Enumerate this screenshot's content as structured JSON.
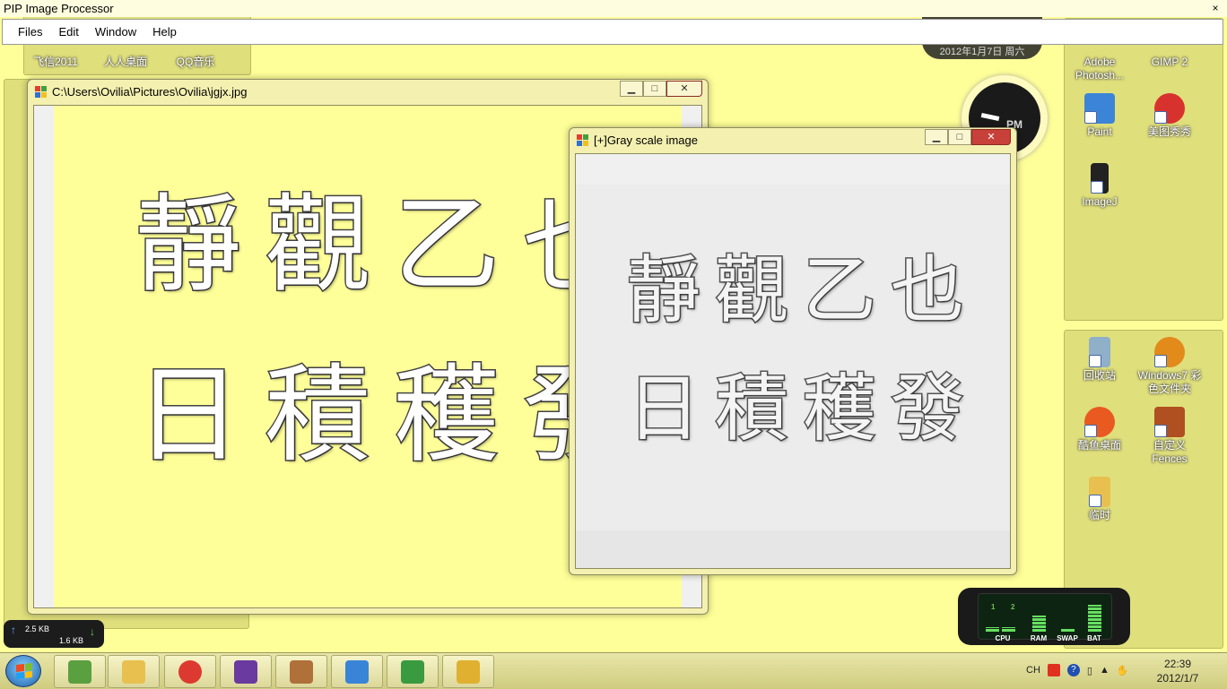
{
  "app": {
    "title": "PIP Image Processor",
    "close": "×"
  },
  "menu": [
    "Files",
    "Edit",
    "Window",
    "Help"
  ],
  "original_window": {
    "title": "C:\\Users\\Ovilia\\Pictures\\Ovilia\\jgjx.jpg",
    "glyphs": [
      "靜",
      "觀",
      "乙",
      "也",
      "日",
      "積",
      "穫",
      "發"
    ]
  },
  "gray_window": {
    "title": "[+]Gray scale image",
    "glyphs": [
      "靜",
      "觀",
      "乙",
      "也",
      "日",
      "積",
      "穫",
      "發"
    ]
  },
  "desktop_icons_left": [
    "飞信2011",
    "人人桌面",
    "QQ音乐"
  ],
  "desktop_icons_right": [
    {
      "label": "Adobe Photosh...",
      "color": "#1d3f74"
    },
    {
      "label": "GIMP 2",
      "color": "#7a6a52"
    },
    {
      "label": "Paint",
      "color": "#3c84d8"
    },
    {
      "label": "美图秀秀",
      "color": "#d8322e"
    },
    {
      "label": "ImageJ",
      "color": "#222222"
    },
    {
      "label": "回收站",
      "color": "#8fb0c8"
    },
    {
      "label": "Windows7 彩色文件夹",
      "color": "#e28a1a"
    },
    {
      "label": "酷鱼桌面",
      "color": "#e85a20"
    },
    {
      "label": "自定义 Fences",
      "color": "#b05020"
    },
    {
      "label": "临时",
      "color": "#e8c050"
    }
  ],
  "clock_gadget": {
    "date": "2012年1月7日 周六",
    "period": "PM"
  },
  "network": {
    "upload": "2.5 KB",
    "download": "1.6 KB"
  },
  "meter": {
    "cores": [
      "1",
      "2"
    ],
    "labels": [
      "CPU",
      "RAM",
      "SWAP",
      "BAT"
    ],
    "levels": {
      "cpu1": 0.15,
      "cpu2": 0.15,
      "ram": 0.55,
      "swap": 0.12,
      "bat": 0.95
    }
  },
  "taskbar": {
    "icons": [
      {
        "name": "notepad-icon",
        "color": "#5aa040"
      },
      {
        "name": "explorer-icon",
        "color": "#e8c050"
      },
      {
        "name": "chrome-icon",
        "color": "#dc3a30"
      },
      {
        "name": "visual-studio-icon",
        "color": "#6a3aa0"
      },
      {
        "name": "fences-icon",
        "color": "#b0703a"
      },
      {
        "name": "paint-icon",
        "color": "#3a84d8"
      },
      {
        "name": "greenshot-icon",
        "color": "#3a9a40"
      },
      {
        "name": "pip-app-icon",
        "color": "#e0b030"
      }
    ],
    "tray": {
      "lang": "CH",
      "time": "22:39",
      "date": "2012/1/7"
    }
  }
}
